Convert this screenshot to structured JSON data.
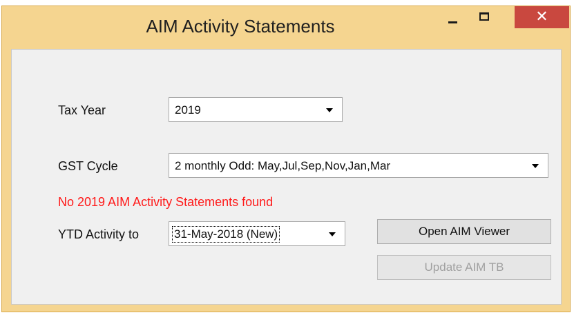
{
  "window": {
    "title": "AIM Activity Statements",
    "close_glyph": "✕",
    "icons": [
      "minimize-icon",
      "maximize-icon",
      "close-icon"
    ]
  },
  "form": {
    "tax_year_label": "Tax Year",
    "tax_year_value": "2019",
    "gst_cycle_label": "GST Cycle",
    "gst_cycle_value": "2 monthly Odd: May,Jul,Sep,Nov,Jan,Mar",
    "error_message": "No 2019 AIM Activity Statements found",
    "ytd_label": "YTD Activity to",
    "ytd_value": "31-May-2018 (New)"
  },
  "buttons": {
    "open_viewer": "Open AIM Viewer",
    "update_tb": "Update AIM TB"
  },
  "colors": {
    "title_bar": "#f5d590",
    "close_button": "#c9483f",
    "error_text": "#ff1a1a",
    "disabled_text": "#a0a0a0"
  }
}
